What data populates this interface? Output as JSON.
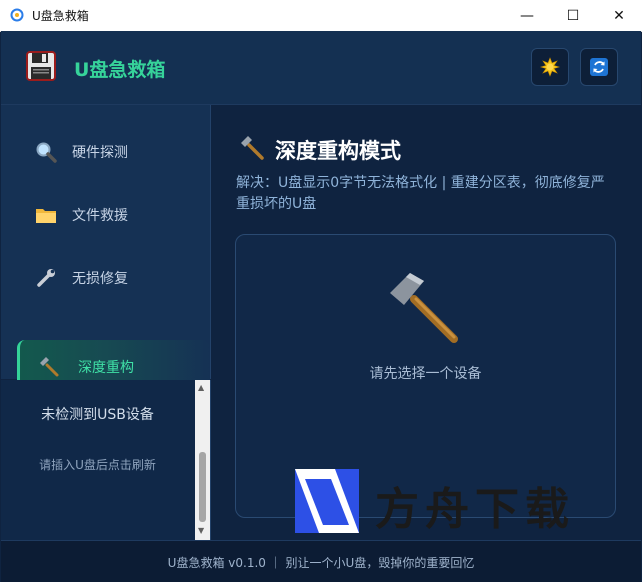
{
  "window": {
    "title": "U盘急救箱",
    "minimize_glyph": "—",
    "maximize_glyph": "☐",
    "close_glyph": "✕"
  },
  "header": {
    "app_name": "U盘急救箱",
    "theme_button_icon": "sun-icon",
    "refresh_button_icon": "refresh-icon"
  },
  "sidebar": {
    "items": [
      {
        "label": "硬件探测",
        "icon": "magnifier-icon",
        "active": false
      },
      {
        "label": "文件救援",
        "icon": "folder-icon",
        "active": false
      },
      {
        "label": "无损修复",
        "icon": "wrench-icon",
        "active": false
      },
      {
        "label": "深度重构",
        "icon": "hammer-icon",
        "active": true
      }
    ]
  },
  "device_panel": {
    "title": "未检测到USB设备",
    "hint": "请插入U盘后点击刷新"
  },
  "main": {
    "mode_title": "深度重构模式",
    "mode_desc": "解决：U盘显示0字节无法格式化 | 重建分区表，彻底修复严重损坏的U盘",
    "placeholder": "请先选择一个设备"
  },
  "footer": {
    "text": "U盘急救箱 v0.1.0 ｜ 别让一个小U盘，毁掉你的重要回忆"
  },
  "watermark": {
    "text": "方舟下载"
  },
  "colors": {
    "accent": "#34d399",
    "background": "#0f2340",
    "header": "#143052",
    "active_item": "#13594d"
  }
}
